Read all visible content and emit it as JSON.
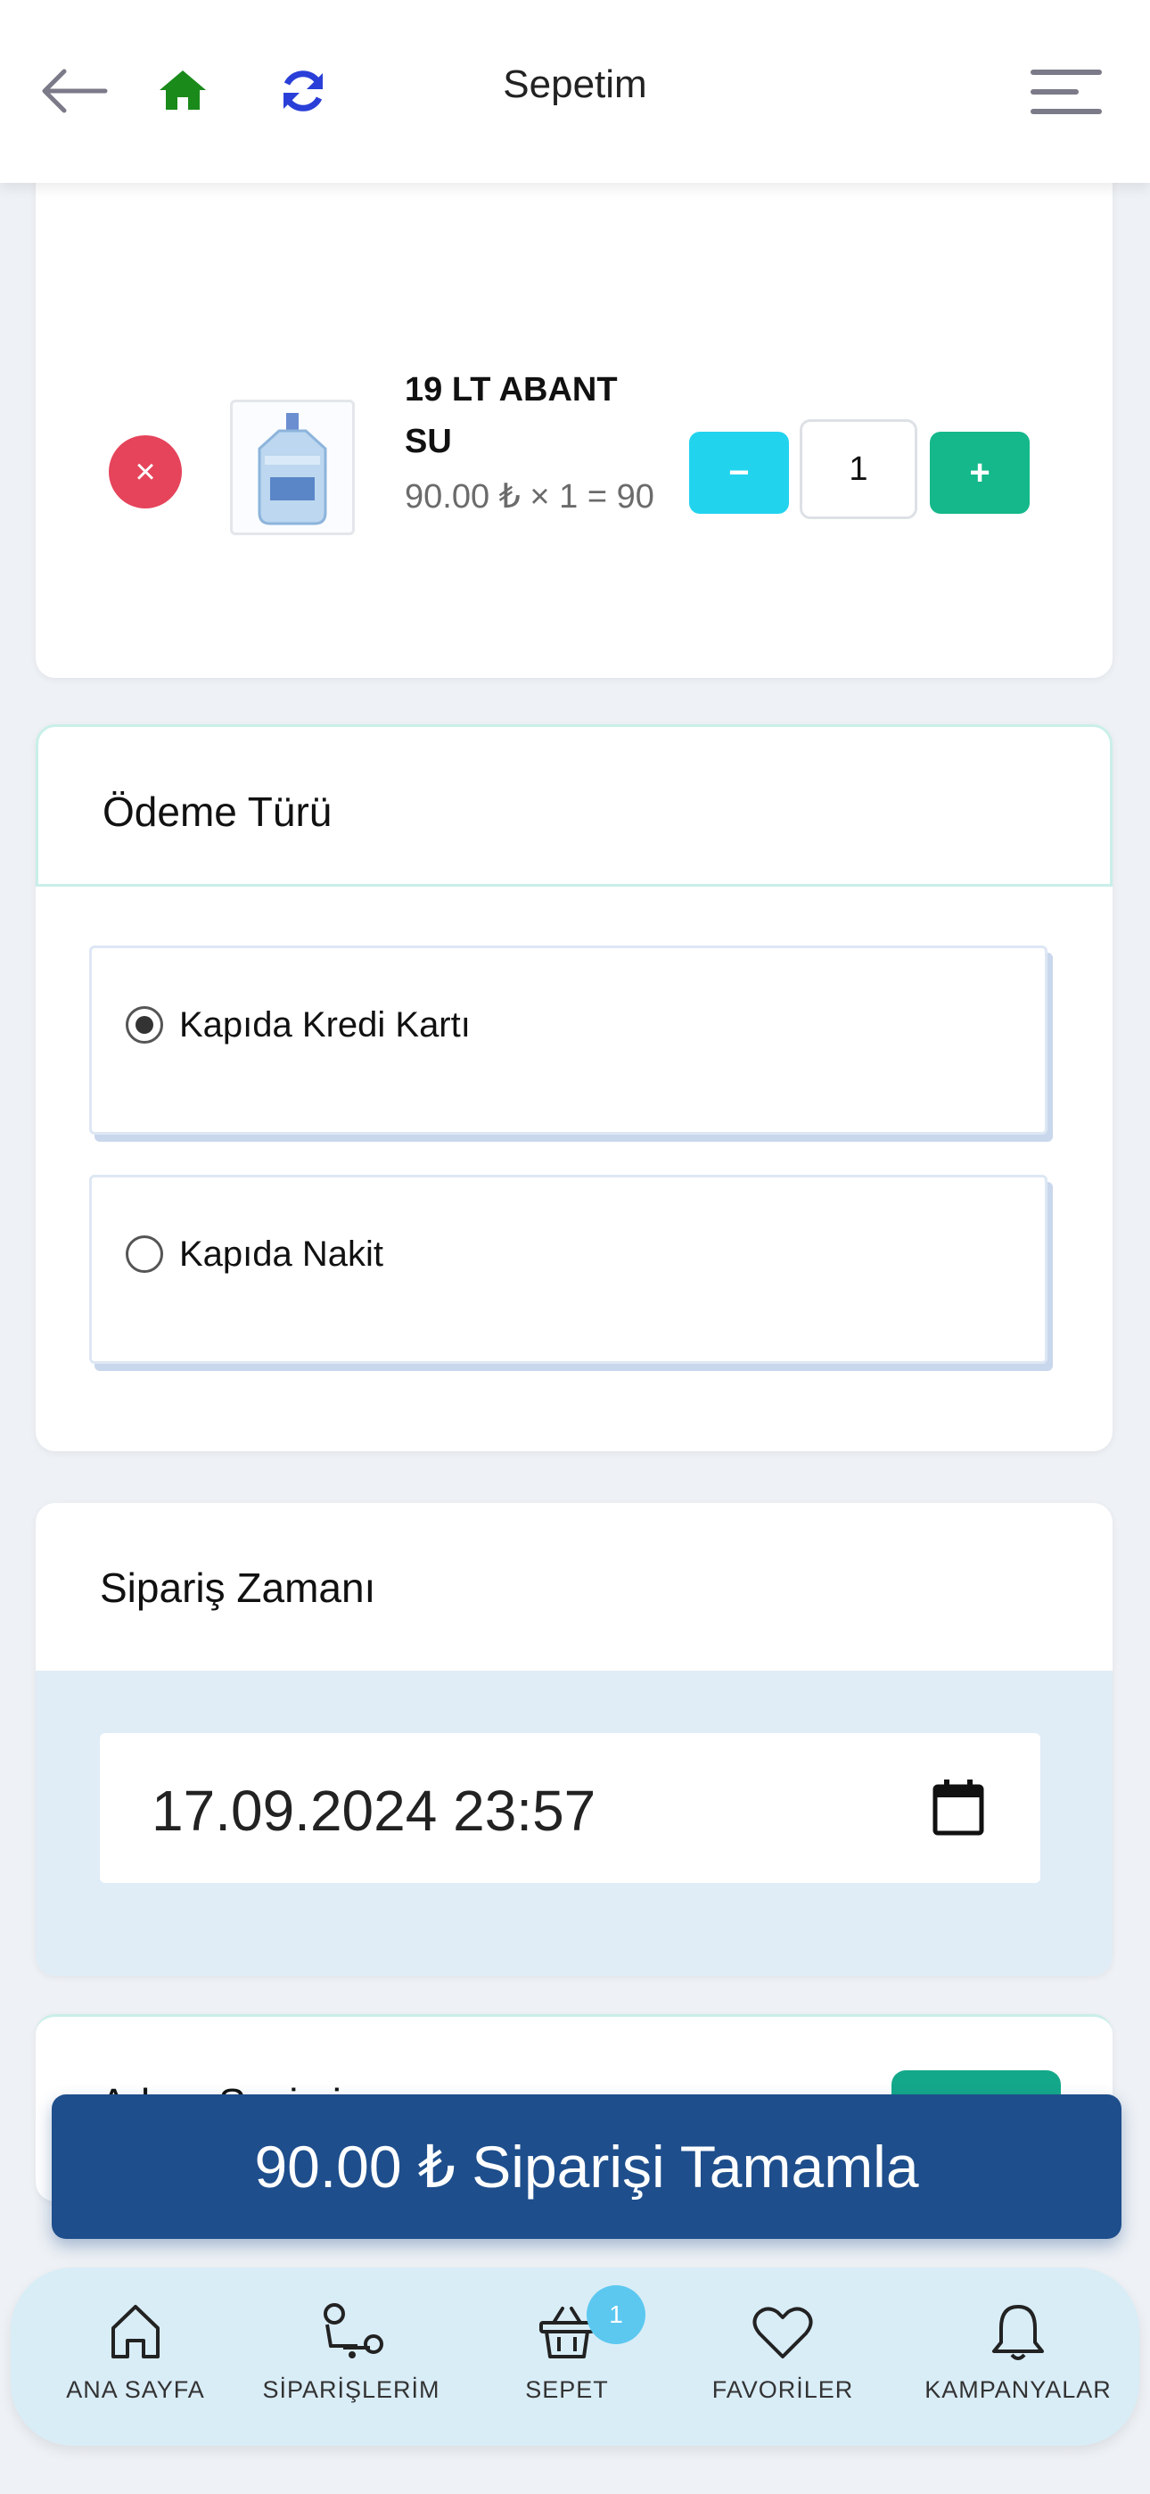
{
  "header": {
    "title": "Sepetim",
    "icons": [
      "back-arrow-icon",
      "home-icon",
      "refresh-icon",
      "menu-icon"
    ]
  },
  "cart": {
    "items": [
      {
        "name": "19 LT ABANT SU",
        "price_line": "90.00 ₺ × 1 = 90",
        "quantity": "1",
        "remove_symbol": "×",
        "minus_symbol": "−",
        "plus_symbol": "+"
      }
    ]
  },
  "payment": {
    "title": "Ödeme Türü",
    "options": [
      {
        "label": "Kapıda Kredi Kartı",
        "selected": true
      },
      {
        "label": "Kapıda Nakit",
        "selected": false
      }
    ]
  },
  "order_time": {
    "title": "Sipariş Zamanı",
    "value": "17.09.2024 23:57"
  },
  "address": {
    "title": "Adres Seçimi"
  },
  "checkout": {
    "label": "90.00 ₺ Siparişi Tamamla"
  },
  "bottom_nav": {
    "items": [
      {
        "label": "ANA SAYFA",
        "icon": "home-outline-icon"
      },
      {
        "label": "SİPARİŞLERİM",
        "icon": "delivery-icon"
      },
      {
        "label": "SEPET",
        "icon": "basket-icon",
        "badge": "1"
      },
      {
        "label": "FAVORİLER",
        "icon": "heart-icon"
      },
      {
        "label": "KAMPANYALAR",
        "icon": "bell-icon"
      }
    ]
  },
  "colors": {
    "primary": "#1e4e8c",
    "danger": "#e5445b",
    "cyan": "#22d3ee",
    "green": "#14b88a",
    "nav_bg": "#d9edf7"
  }
}
